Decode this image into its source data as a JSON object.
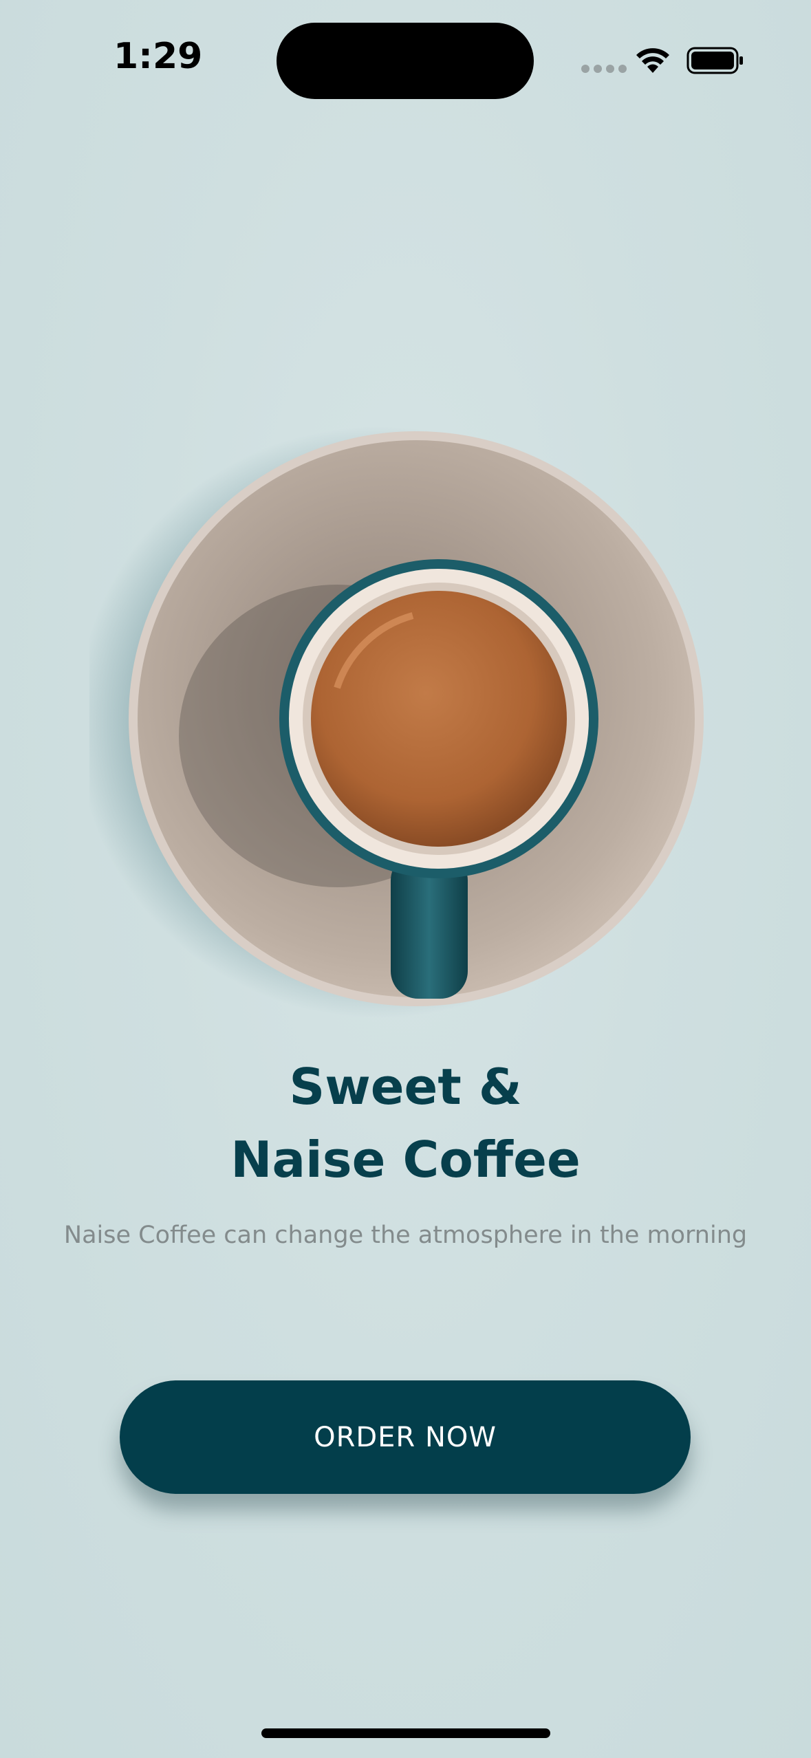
{
  "status_bar": {
    "time": "1:29"
  },
  "hero": {
    "title_line1": "Sweet &",
    "title_line2": "Naise Coffee",
    "subtitle": "Naise Coffee can change the atmosphere in the morning"
  },
  "cta": {
    "label": "ORDER NOW"
  },
  "colors": {
    "background": "#cfdfe0",
    "primary": "#033e4b",
    "title": "#073f4c",
    "subtitle": "#838b8c",
    "saucer": "#b4a79b",
    "cup": "#1b5a66",
    "coffee": "#b2693a"
  },
  "icons": {
    "signal": "cellular-signal-icon",
    "wifi": "wifi-icon",
    "battery": "battery-icon"
  }
}
